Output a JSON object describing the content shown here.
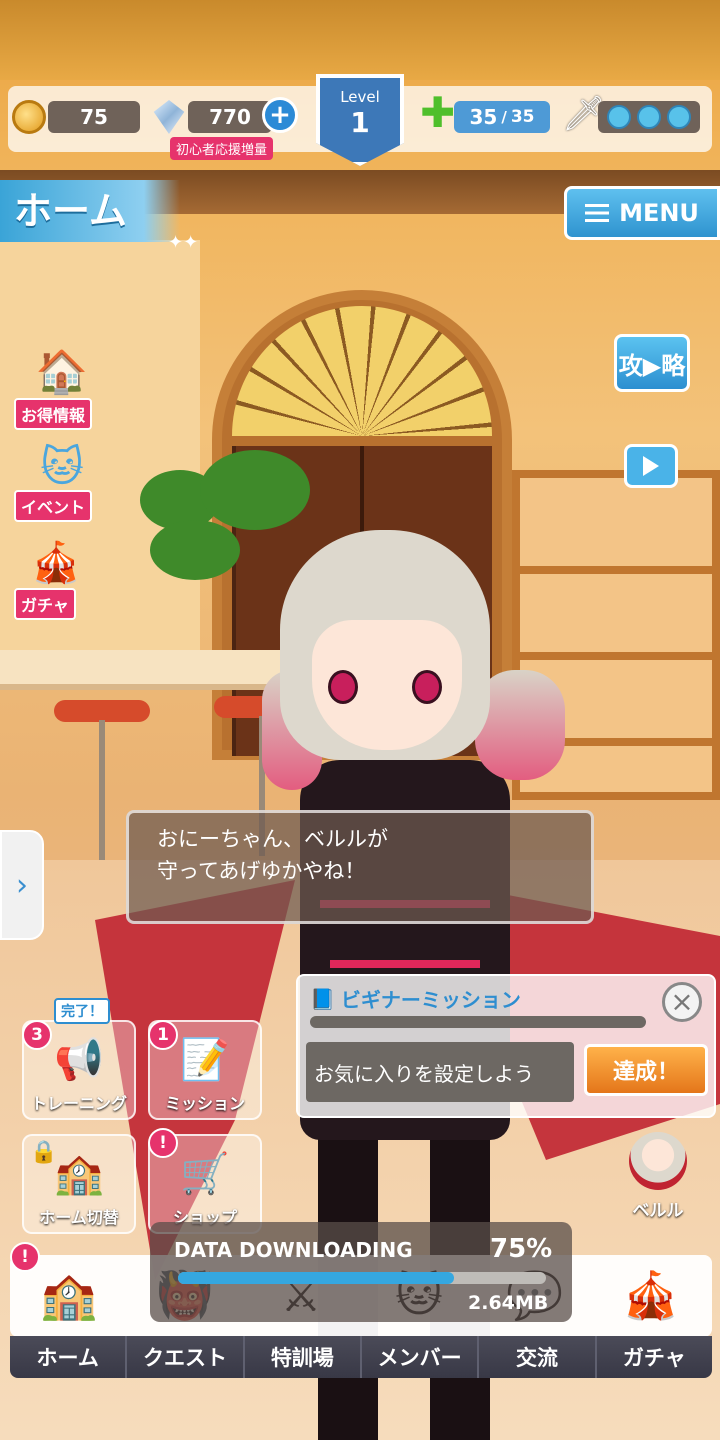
{
  "currency": {
    "coins": "75",
    "gems": "770",
    "gem_tag": "初心者応援増量"
  },
  "level": {
    "label": "Level",
    "value": "1"
  },
  "stamina": {
    "current": "35",
    "max": "35"
  },
  "screen": {
    "title": "ホーム",
    "menu_label": "MENU"
  },
  "right_buttons": {
    "strategy_label": "攻▶略"
  },
  "left_menu": [
    {
      "label": "お得情報",
      "icon": "house-info-icon"
    },
    {
      "label": "イベント",
      "icon": "event-character-icon"
    },
    {
      "label": "ガチャ",
      "icon": "curtain-icon"
    }
  ],
  "dialogue": {
    "line1": "おにーちゃん、ベルルが",
    "line2": "守ってあげゆかやね！"
  },
  "mission": {
    "title": "ビギナーミッション",
    "task": "お気に入りを設定しよう",
    "button": "達成！",
    "progress": 0
  },
  "actions": [
    {
      "label": "トレーニング",
      "badge": "3",
      "done": "完了！",
      "icon": "megaphone-icon"
    },
    {
      "label": "ミッション",
      "badge": "1",
      "icon": "checklist-icon"
    },
    {
      "label": "ホーム切替",
      "icon": "home-switch-icon",
      "locked": true
    },
    {
      "label": "ショップ",
      "badge": "!",
      "icon": "cart-icon"
    }
  ],
  "character": {
    "name": "ベルル"
  },
  "download": {
    "label": "DATA DOWNLOADING",
    "percent": "75%",
    "progress": 0.75,
    "size": "2.64MB"
  },
  "nav": {
    "badge": "!",
    "tabs": [
      "ホーム",
      "クエスト",
      "特訓場",
      "メンバー",
      "交流",
      "ガチャ"
    ]
  },
  "colors": {
    "accent_blue": "#2f93cf",
    "pink": "#e6336c",
    "orange": "#e4761a"
  }
}
